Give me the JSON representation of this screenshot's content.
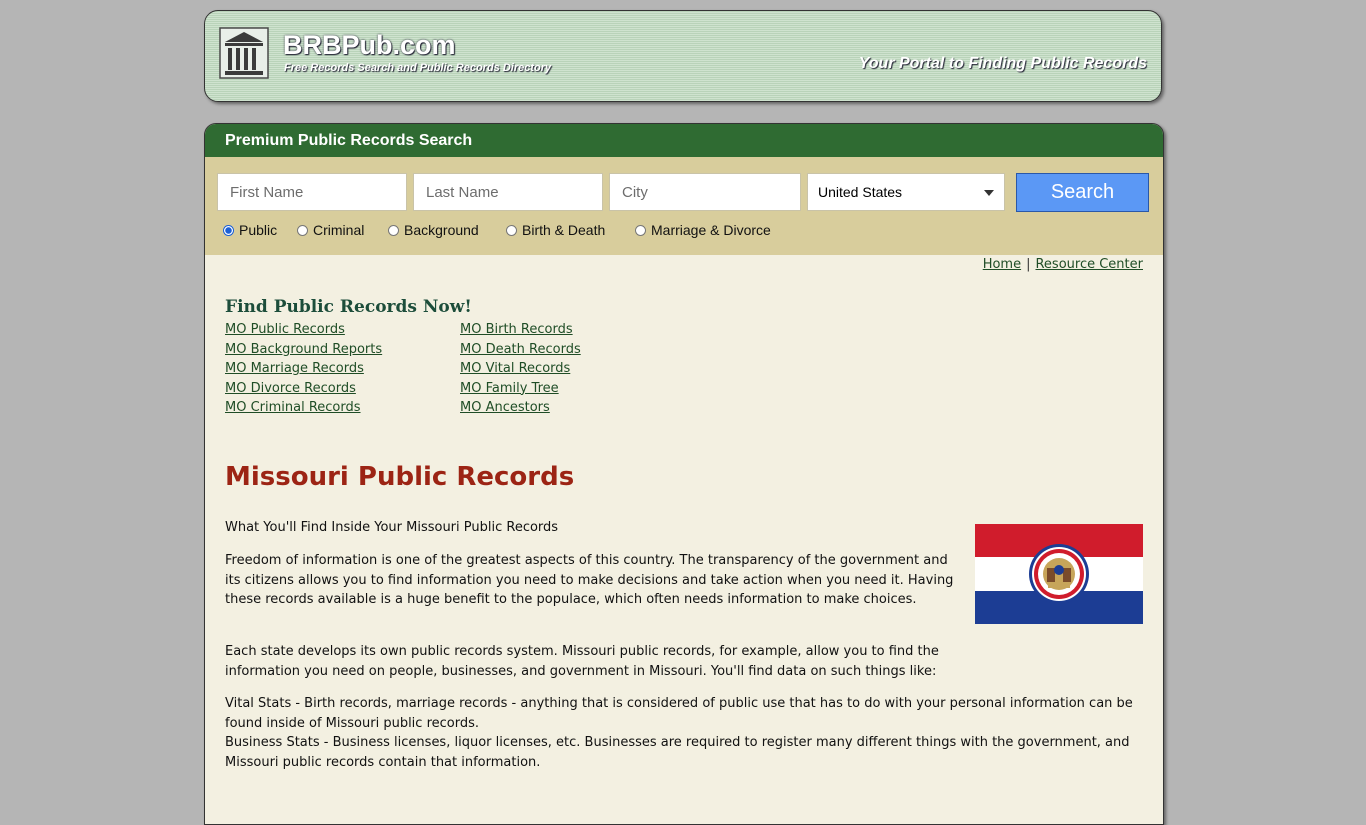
{
  "header": {
    "brand": "BRBPub.com",
    "tagline": "Free Records Search and Public Records Directory",
    "portal": "Your Portal to Finding Public Records"
  },
  "search": {
    "heading": "Premium Public Records Search",
    "first_name_placeholder": "First Name",
    "last_name_placeholder": "Last Name",
    "city_placeholder": "City",
    "country": "United States",
    "button": "Search",
    "radios": [
      {
        "label": "Public",
        "checked": true
      },
      {
        "label": "Criminal",
        "checked": false
      },
      {
        "label": "Background",
        "checked": false
      },
      {
        "label": "Birth & Death",
        "checked": false
      },
      {
        "label": "Marriage & Divorce",
        "checked": false
      }
    ]
  },
  "nav": {
    "home": "Home",
    "separator": "|",
    "resource": "Resource Center"
  },
  "find": {
    "title": "Find Public Records Now!",
    "left": [
      "MO Public Records",
      "MO Background Reports",
      "MO Marriage Records",
      "MO Divorce Records",
      "MO Criminal Records"
    ],
    "right": [
      "MO Birth Records",
      "MO Death Records",
      "MO Vital Records",
      "MO Family Tree",
      "MO Ancestors"
    ]
  },
  "article": {
    "title": "Missouri Public Records",
    "intro": "What You'll Find Inside Your Missouri Public Records",
    "p1": "Freedom of information is one of the greatest aspects of this country. The transparency of the government and its citizens allows you to find information you need to make decisions and take action when you need it. Having these records available is a huge benefit to the populace, which often needs information to make choices.",
    "p2": "Each state develops its own public records system. Missouri public records, for example, allow you to find the information you need on people, businesses, and government in Missouri. You'll find data on such things like:",
    "p3": "Vital Stats - Birth records, marriage records - anything that is considered of public use that has to do with your personal information can be found inside of Missouri public records.",
    "p4": "Business Stats - Business licenses, liquor licenses, etc. Businesses are required to register many different things with the government, and Missouri public records contain that information."
  },
  "colors": {
    "green": "#2f6b32",
    "tan": "#d8cd9c",
    "title_red": "#9c2414",
    "button_blue": "#5b98f5"
  }
}
